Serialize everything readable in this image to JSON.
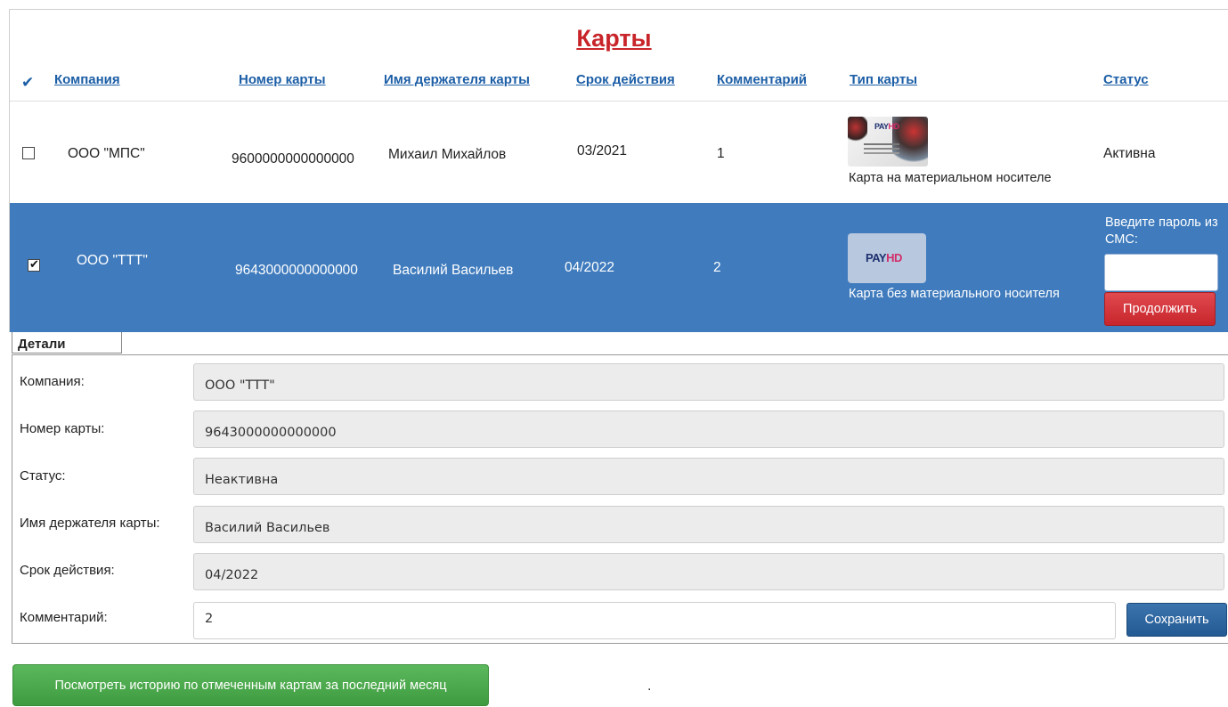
{
  "title": "Карты",
  "columns": {
    "check": "✔",
    "company": "Компания",
    "card_number": "Номер карты",
    "holder": "Имя держателя карты",
    "expiry": "Срок действия",
    "comment": "Комментарий",
    "card_type": "Тип карты",
    "status": "Статус"
  },
  "rows": [
    {
      "checked": false,
      "company": "ООО \"МПС\"",
      "card_number": "9600000000000000",
      "holder": "Михаил Михайлов",
      "expiry": "03/2021",
      "comment": "1",
      "card_type": "Карта на материальном носителе",
      "card_image_icon": "payhd-physical-card-icon",
      "status": "Активна"
    },
    {
      "checked": true,
      "company": "ООО \"ТТТ\"",
      "card_number": "9643000000000000",
      "holder": "Василий Васильев",
      "expiry": "04/2022",
      "comment": "2",
      "card_type": "Карта без материального носителя",
      "card_image_icon": "payhd-virtual-card-icon",
      "status_prompt": "Введите пароль из СМС:",
      "continue_label": "Продолжить"
    }
  ],
  "card_logo": {
    "pay": "PAY",
    "hd": "HD"
  },
  "details": {
    "tab_label": "Детали",
    "fields": [
      {
        "label": "Компания:",
        "value": "ООО \"ТТТ\""
      },
      {
        "label": "Номер карты:",
        "value": "9643000000000000"
      },
      {
        "label": "Статус:",
        "value": "Неактивна"
      },
      {
        "label": "Имя держателя карты:",
        "value": "Василий Васильев"
      },
      {
        "label": "Срок действия:",
        "value": "04/2022"
      },
      {
        "label": "Комментарий:",
        "value": "2"
      }
    ],
    "save_label": "Сохранить"
  },
  "history_button": "Посмотреть историю по отмеченным картам за последний месяц",
  "dot": ".",
  "colors": {
    "title": "#c8252a",
    "header_link": "#1c5ea6",
    "selected_row": "#3f7bbd",
    "continue_button": "#c7262c",
    "save_button": "#235a93",
    "history_button": "#4cae4c"
  }
}
